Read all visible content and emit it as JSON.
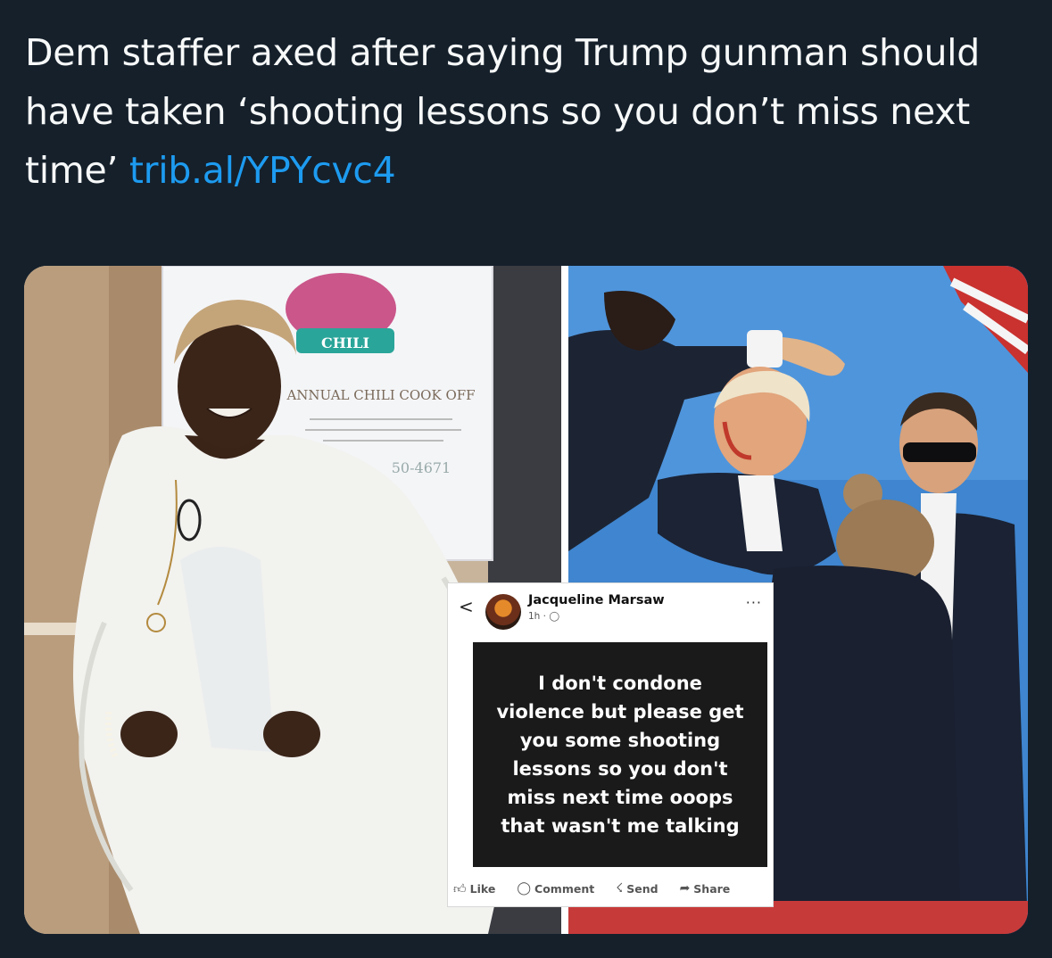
{
  "tweet": {
    "text": "Dem staffer axed after saying Trump gunman should have taken ‘shooting lessons so you don’t miss next time’ ",
    "link": "trib.al/YPYcvc4",
    "link_color": "#1d9bf0"
  },
  "poster": {
    "brand": "CHILI",
    "title": "ANNUAL CHILI COOK OFF",
    "number": "50-4671"
  },
  "facebook_post": {
    "author": "Jacqueline Marsaw",
    "time": "1h",
    "back_icon": "chevron-left-icon",
    "more_icon": "more-dots-icon",
    "post_text": "I don't condone\nviolence but please get\nyou some  shooting\nlessons so you don't\nmiss next time ooops\nthat wasn't me talking",
    "actions": [
      {
        "label": "Like",
        "icon": "thumbs-up-icon"
      },
      {
        "label": "Comment",
        "icon": "comment-icon"
      },
      {
        "label": "Send",
        "icon": "messenger-icon"
      },
      {
        "label": "Share",
        "icon": "share-icon"
      }
    ]
  }
}
